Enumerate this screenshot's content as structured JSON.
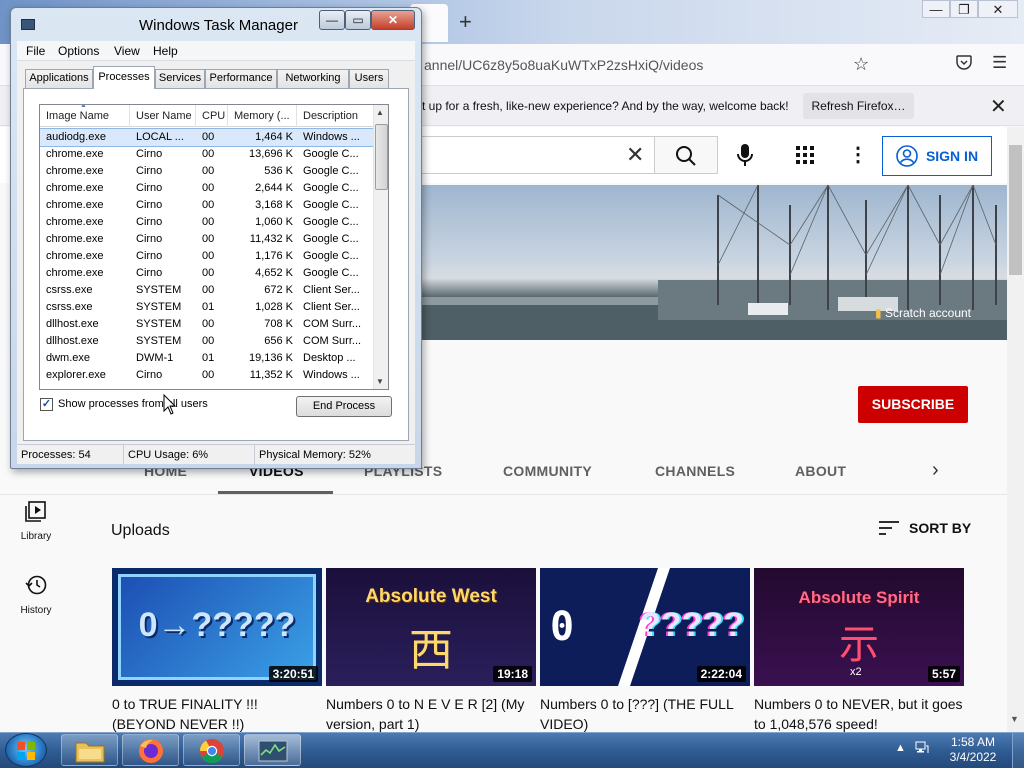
{
  "firefox": {
    "new_tab_glyph": "+",
    "window_controls": [
      "—",
      "❐",
      "✕"
    ],
    "url": "annel/UC6z8y5o8uaKuWTxP2zsHxiQ/videos",
    "notice": "t up for a fresh, like-new experience? And by the way, welcome back!",
    "refresh_button": "Refresh Firefox…",
    "close_glyph": "✕"
  },
  "youtube": {
    "sign_in": "SIGN IN",
    "scratch_account": "Scratch account",
    "subscribe": "SUBSCRIBE",
    "tabs": [
      "HOME",
      "VIDEOS",
      "PLAYLISTS",
      "COMMUNITY",
      "CHANNELS",
      "ABOUT"
    ],
    "guide": [
      {
        "label": "Library",
        "icon": "library-icon"
      },
      {
        "label": "History",
        "icon": "history-icon"
      }
    ],
    "uploads_heading": "Uploads",
    "sort_by": "SORT BY",
    "videos": [
      {
        "thumb_text": "0→?????",
        "duration": "3:20:51",
        "title": "0 to TRUE FINALITY !!! (BEYOND NEVER !!)"
      },
      {
        "thumb_text": "Absolute West",
        "thumb_glyph": "西",
        "duration": "19:18",
        "title": "Numbers 0 to N E V E R [2] (My version, part 1)"
      },
      {
        "thumb_text": "0",
        "thumb_text2": "?????",
        "duration": "2:22:04",
        "title": "Numbers 0 to [???] (THE FULL VIDEO)"
      },
      {
        "thumb_text": "Absolute Spirit",
        "thumb_glyph": "示",
        "thumb_badge": "x2",
        "duration": "5:57",
        "title": "Numbers 0 to NEVER, but it goes to 1,048,576 speed!"
      }
    ]
  },
  "taskmgr": {
    "title": "Windows Task Manager",
    "menu": [
      "File",
      "Options",
      "View",
      "Help"
    ],
    "tabs": [
      "Applications",
      "Processes",
      "Services",
      "Performance",
      "Networking",
      "Users"
    ],
    "active_tab": "Processes",
    "columns": [
      "Image Name",
      "User Name",
      "CPU",
      "Memory (...",
      "Description"
    ],
    "rows": [
      {
        "image": "audiodg.exe",
        "user": "LOCAL ...",
        "cpu": "00",
        "mem": "1,464 K",
        "desc": "Windows ..."
      },
      {
        "image": "chrome.exe",
        "user": "Cirno",
        "cpu": "00",
        "mem": "13,696 K",
        "desc": "Google C..."
      },
      {
        "image": "chrome.exe",
        "user": "Cirno",
        "cpu": "00",
        "mem": "536 K",
        "desc": "Google C..."
      },
      {
        "image": "chrome.exe",
        "user": "Cirno",
        "cpu": "00",
        "mem": "2,644 K",
        "desc": "Google C..."
      },
      {
        "image": "chrome.exe",
        "user": "Cirno",
        "cpu": "00",
        "mem": "3,168 K",
        "desc": "Google C..."
      },
      {
        "image": "chrome.exe",
        "user": "Cirno",
        "cpu": "00",
        "mem": "1,060 K",
        "desc": "Google C..."
      },
      {
        "image": "chrome.exe",
        "user": "Cirno",
        "cpu": "00",
        "mem": "11,432 K",
        "desc": "Google C..."
      },
      {
        "image": "chrome.exe",
        "user": "Cirno",
        "cpu": "00",
        "mem": "1,176 K",
        "desc": "Google C..."
      },
      {
        "image": "chrome.exe",
        "user": "Cirno",
        "cpu": "00",
        "mem": "4,652 K",
        "desc": "Google C..."
      },
      {
        "image": "csrss.exe",
        "user": "SYSTEM",
        "cpu": "00",
        "mem": "672 K",
        "desc": "Client Ser..."
      },
      {
        "image": "csrss.exe",
        "user": "SYSTEM",
        "cpu": "01",
        "mem": "1,028 K",
        "desc": "Client Ser..."
      },
      {
        "image": "dllhost.exe",
        "user": "SYSTEM",
        "cpu": "00",
        "mem": "708 K",
        "desc": "COM Surr..."
      },
      {
        "image": "dllhost.exe",
        "user": "SYSTEM",
        "cpu": "00",
        "mem": "656 K",
        "desc": "COM Surr..."
      },
      {
        "image": "dwm.exe",
        "user": "DWM-1",
        "cpu": "01",
        "mem": "19,136 K",
        "desc": "Desktop ..."
      },
      {
        "image": "explorer.exe",
        "user": "Cirno",
        "cpu": "00",
        "mem": "11,352 K",
        "desc": "Windows ..."
      }
    ],
    "show_all_label": "Show processes from all users",
    "show_all_checked": true,
    "end_process": "End Process",
    "status": {
      "processes": "Processes: 54",
      "cpu": "CPU Usage: 6%",
      "memory": "Physical Memory: 52%"
    }
  },
  "taskbar": {
    "apps": [
      {
        "name": "explorer",
        "icon": "folder-icon"
      },
      {
        "name": "firefox",
        "icon": "firefox-icon"
      },
      {
        "name": "chrome",
        "icon": "chrome-icon"
      },
      {
        "name": "task-manager",
        "icon": "task-manager-icon"
      }
    ],
    "time": "1:58 AM",
    "date": "3/4/2022"
  }
}
